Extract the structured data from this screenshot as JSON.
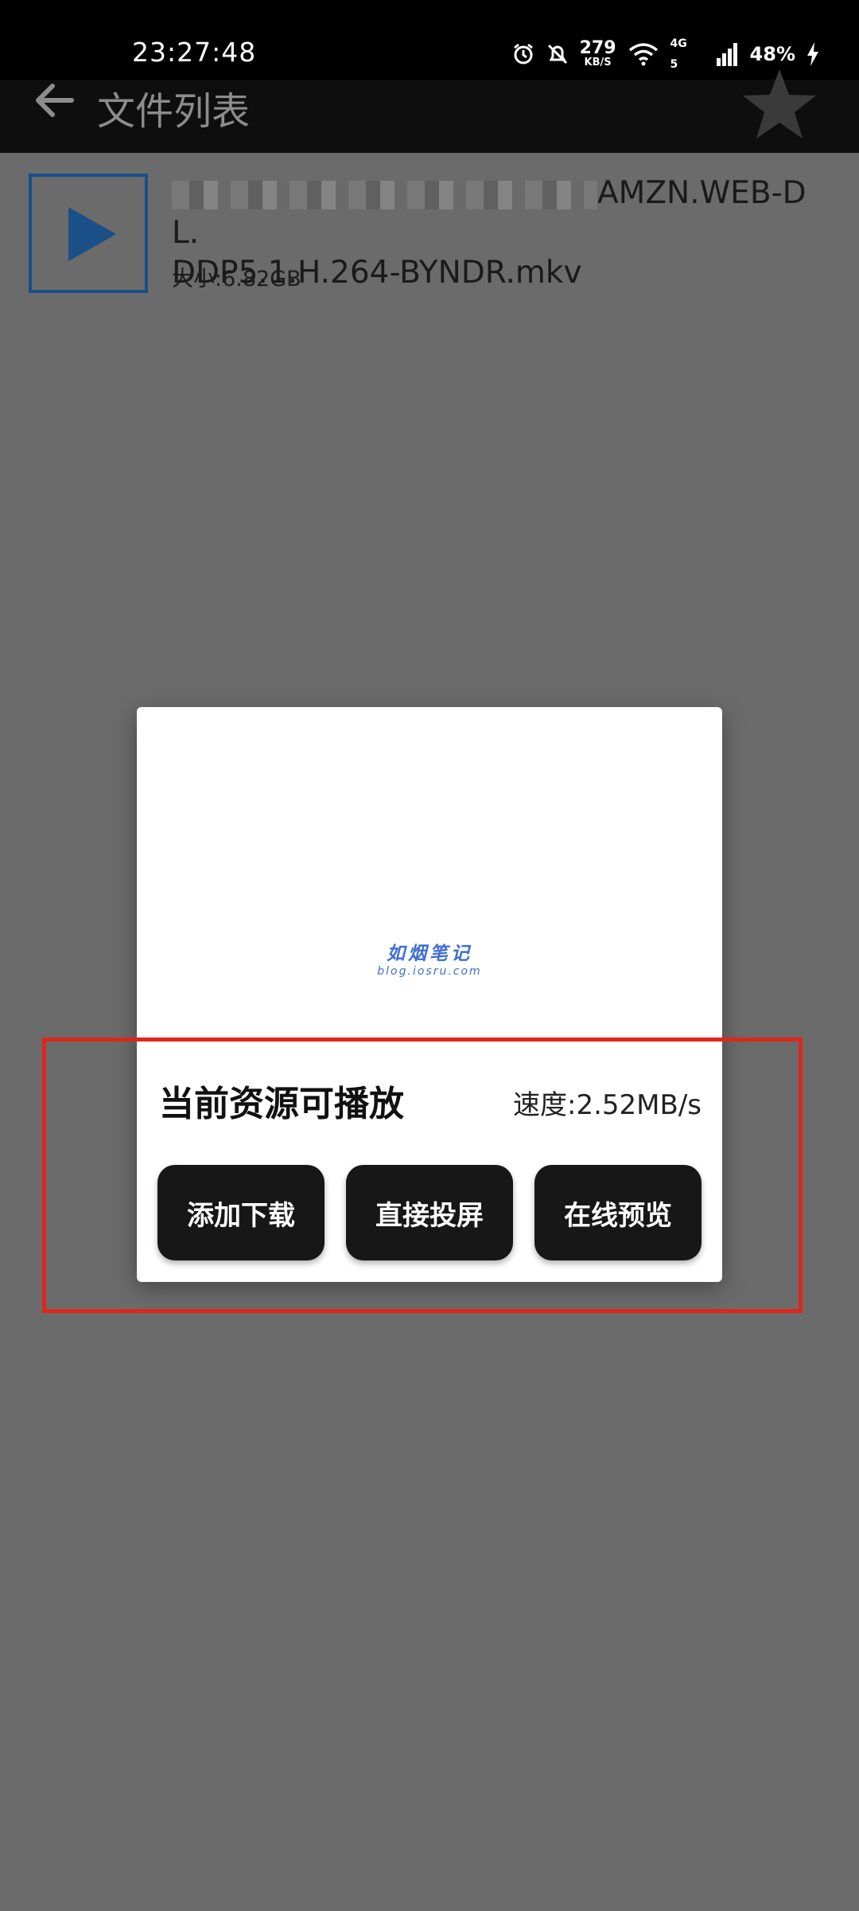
{
  "status_bar": {
    "time": "23:27:48",
    "net_speed_value": "279",
    "net_speed_unit": "KB/S",
    "signal_label_top": "4G",
    "signal_label_bottom": "5",
    "battery": "48%"
  },
  "toolbar": {
    "title": "文件列表"
  },
  "file": {
    "name_visible_suffix": "AMZN.WEB-DL.",
    "name_line2": "DDP5.1.H.264-BYNDR.mkv",
    "size": "大小:6.82GB"
  },
  "dialog": {
    "watermark_title": "如烟笔记",
    "watermark_sub": "blog.iosru.com",
    "title": "当前资源可播放",
    "speed": "速度:2.52MB/s",
    "buttons": {
      "download": "添加下载",
      "cast": "直接投屏",
      "preview": "在线预览"
    }
  },
  "colors": {
    "overlay_bg": "#6b6b6b",
    "button_bg": "#171717",
    "highlight_red": "#e1251b",
    "thumb_blue": "#1b4f87"
  }
}
